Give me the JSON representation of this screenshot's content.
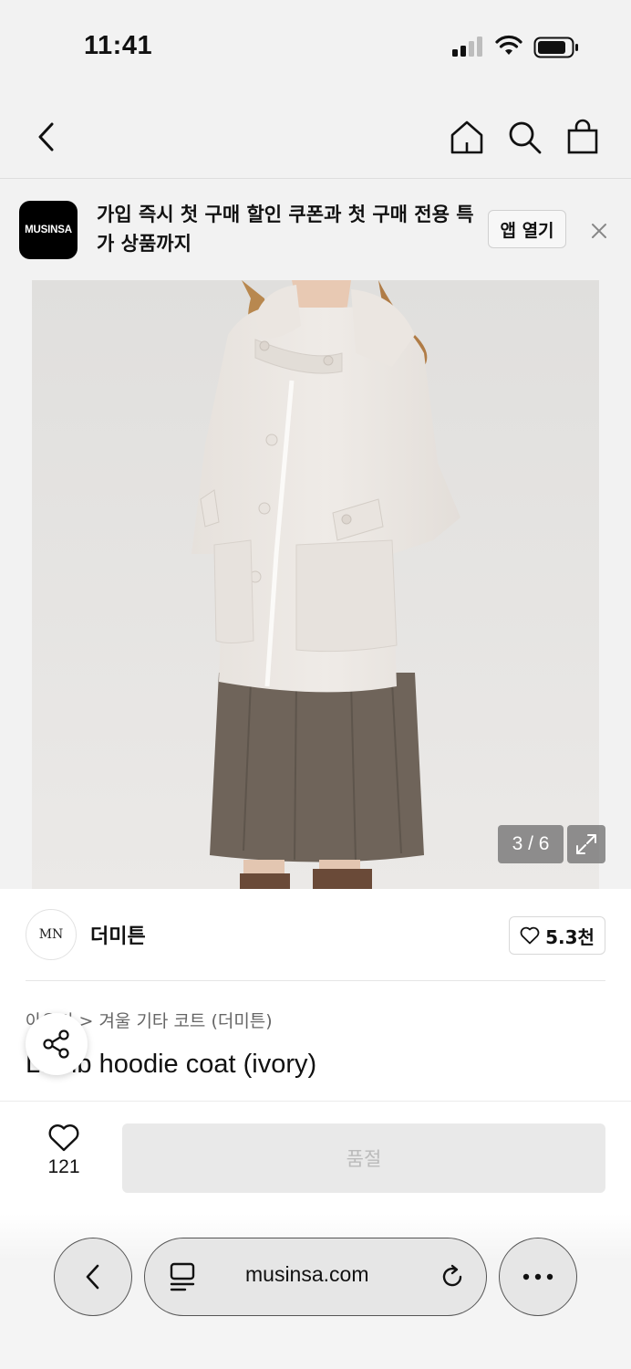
{
  "status_bar": {
    "time": "11:41"
  },
  "promo": {
    "logo_text": "MUSINSA",
    "message": "가입 즉시 첫 구매 할인 쿠폰과 첫 구매 전용 특가 상품까지",
    "open_app_label": "앱 열기"
  },
  "gallery": {
    "counter": "3 / 6",
    "current": 3,
    "total": 6
  },
  "brand": {
    "logo_text": "MN",
    "name": "더미튼",
    "likes": "5.3천"
  },
  "product": {
    "breadcrumb": "아우터 > 겨울 기타 코트 (더미튼)",
    "title": "Lamb hoodie coat (ivory)"
  },
  "actions": {
    "wish_count": "121",
    "buy_label": "품절"
  },
  "browser": {
    "url": "musinsa.com"
  },
  "colors": {
    "accent_black": "#000000",
    "soldout_bg": "#e9e9e9",
    "soldout_text": "#bbbbbb"
  }
}
